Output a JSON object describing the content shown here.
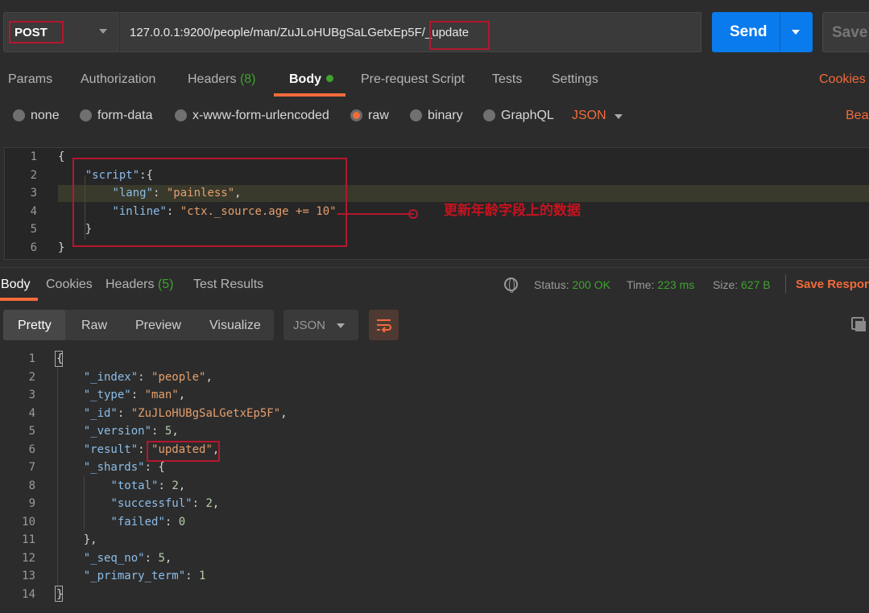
{
  "request": {
    "method": "POST",
    "url": "127.0.0.1:9200/people/man/ZuJLoHUBgSaLGetxEp5F/_update",
    "send_label": "Send",
    "save_label": "Save"
  },
  "request_tabs": [
    {
      "label": "Params"
    },
    {
      "label": "Authorization"
    },
    {
      "label": "Headers",
      "count": "(8)"
    },
    {
      "label": "Body"
    },
    {
      "label": "Pre-request Script"
    },
    {
      "label": "Tests"
    },
    {
      "label": "Settings"
    }
  ],
  "cookies_link": "Cookies",
  "body_types": [
    "none",
    "form-data",
    "x-www-form-urlencoded",
    "raw",
    "binary",
    "GraphQL"
  ],
  "body_format": "JSON",
  "beautify_label": "Bea",
  "request_body": {
    "line_numbers": [
      "1",
      "2",
      "3",
      "4",
      "5",
      "6"
    ],
    "lines": [
      [
        "{"
      ],
      [
        "    ",
        {
          "k": "\"script\""
        },
        ":{"
      ],
      [
        "        ",
        {
          "k": "\"lang\""
        },
        ": ",
        {
          "s": "\"painless\""
        },
        ","
      ],
      [
        "        ",
        {
          "k": "\"inline\""
        },
        ": ",
        {
          "s": "\"ctx._source.age += 10\""
        }
      ],
      [
        "    }"
      ],
      [
        "}"
      ]
    ],
    "annotation": "更新年龄字段上的数据"
  },
  "response_tabs": [
    {
      "label": "Body"
    },
    {
      "label": "Cookies"
    },
    {
      "label": "Headers",
      "count": "(5)"
    },
    {
      "label": "Test Results"
    }
  ],
  "response_meta": {
    "status_label": "Status:",
    "status_value": "200 OK",
    "time_label": "Time:",
    "time_value": "223 ms",
    "size_label": "Size:",
    "size_value": "627 B",
    "save_response": "Save Respon"
  },
  "view_modes": [
    "Pretty",
    "Raw",
    "Preview",
    "Visualize"
  ],
  "response_format": "JSON",
  "response_body": {
    "line_numbers": [
      "1",
      "2",
      "3",
      "4",
      "5",
      "6",
      "7",
      "8",
      "9",
      "10",
      "11",
      "12",
      "13",
      "14"
    ],
    "lines": [
      [
        "{"
      ],
      [
        "    ",
        {
          "k": "\"_index\""
        },
        ": ",
        {
          "s": "\"people\""
        },
        ","
      ],
      [
        "    ",
        {
          "k": "\"_type\""
        },
        ": ",
        {
          "s": "\"man\""
        },
        ","
      ],
      [
        "    ",
        {
          "k": "\"_id\""
        },
        ": ",
        {
          "s": "\"ZuJLoHUBgSaLGetxEp5F\""
        },
        ","
      ],
      [
        "    ",
        {
          "k": "\"_version\""
        },
        ": ",
        {
          "n": "5"
        },
        ","
      ],
      [
        "    ",
        {
          "k": "\"result\""
        },
        ": ",
        {
          "s": "\"updated\""
        },
        ","
      ],
      [
        "    ",
        {
          "k": "\"_shards\""
        },
        ": {"
      ],
      [
        "        ",
        {
          "k": "\"total\""
        },
        ": ",
        {
          "n": "2"
        },
        ","
      ],
      [
        "        ",
        {
          "k": "\"successful\""
        },
        ": ",
        {
          "n": "2"
        },
        ","
      ],
      [
        "        ",
        {
          "k": "\"failed\""
        },
        ": ",
        {
          "n": "0"
        }
      ],
      [
        "    },"
      ],
      [
        "    ",
        {
          "k": "\"_seq_no\""
        },
        ": ",
        {
          "n": "5"
        },
        ","
      ],
      [
        "    ",
        {
          "k": "\"_primary_term\""
        },
        ": ",
        {
          "n": "1"
        }
      ],
      [
        "}"
      ]
    ]
  },
  "colors": {
    "accent": "#f26b3a",
    "send": "#097bed",
    "success": "#3fa32e",
    "highlight_box": "#b5172e"
  }
}
